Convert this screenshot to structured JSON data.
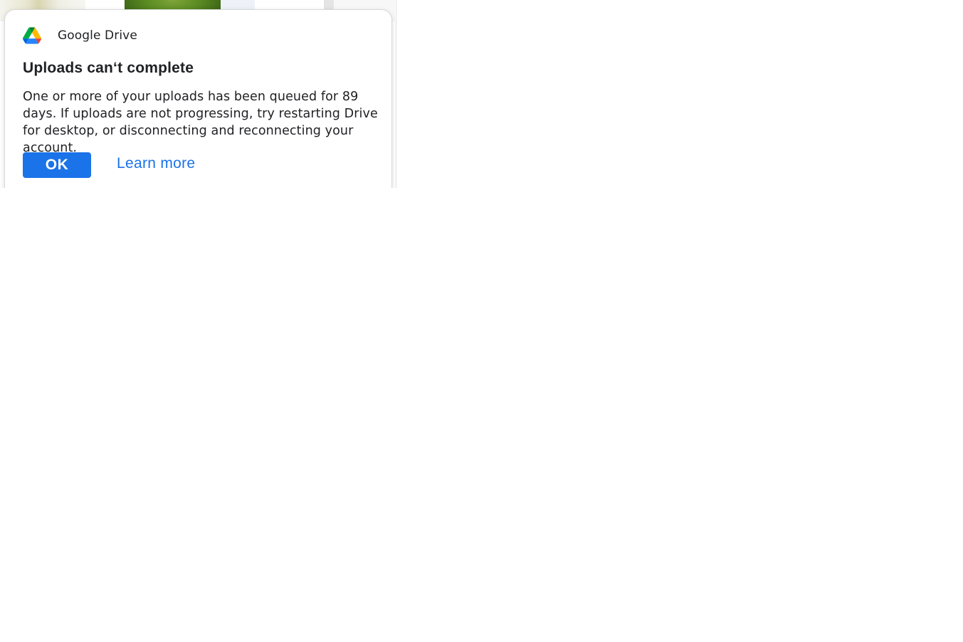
{
  "notification": {
    "app_name": "Google Drive",
    "app_icon": "google-drive-logo",
    "title": "Uploads can‘t complete",
    "message": "One or more of your uploads has been queued for 89 days. If uploads are not progressing, try restarting Drive for desktop, or disconnecting and reconnecting your account.",
    "ok_label": "OK",
    "learn_more_label": "Learn more"
  },
  "colors": {
    "accent": "#1a73e8",
    "text": "#202124",
    "drive_green": "#0f9d58",
    "drive_yellow": "#fbbc04",
    "drive_blue": "#4285f4",
    "drive_red": "#ea4335"
  }
}
